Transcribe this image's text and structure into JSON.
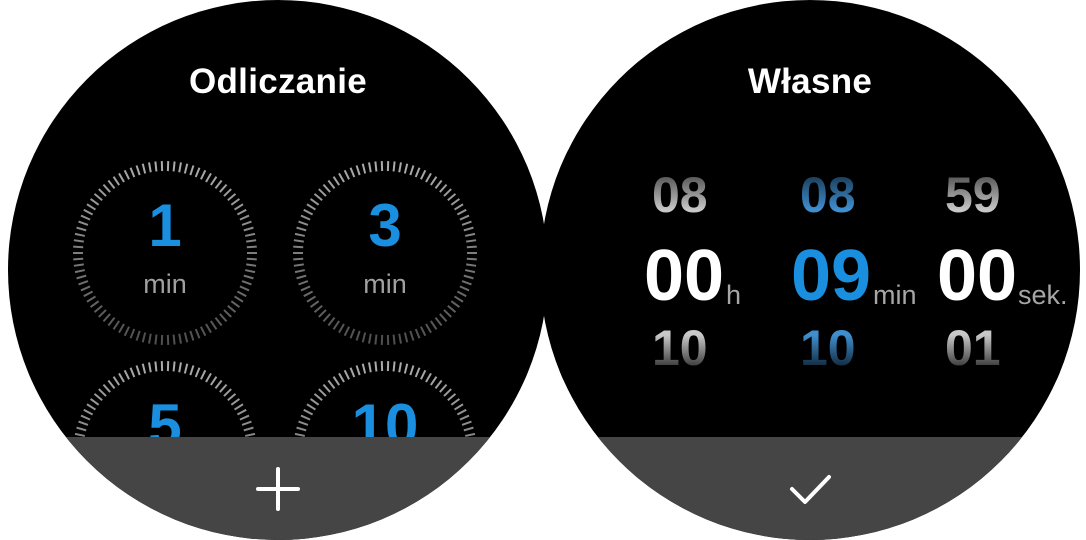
{
  "countdown": {
    "title": "Odliczanie",
    "presets": [
      {
        "value": "1",
        "unit": "min"
      },
      {
        "value": "3",
        "unit": "min"
      },
      {
        "value": "5",
        "unit": ""
      },
      {
        "value": "10",
        "unit": ""
      }
    ],
    "add_icon": "plus-icon"
  },
  "custom": {
    "title": "Własne",
    "hours": {
      "prev": "08",
      "current": "00",
      "next": "10",
      "unit": "h"
    },
    "minutes": {
      "prev": "08",
      "current": "09",
      "next": "10",
      "unit": "min"
    },
    "seconds": {
      "prev": "59",
      "current": "00",
      "next": "01",
      "unit": "sek."
    },
    "confirm_icon": "checkmark-icon"
  },
  "colors": {
    "accent": "#1a8fe0",
    "background": "#000000",
    "bar": "#454545",
    "muted": "#a0a0a0"
  }
}
